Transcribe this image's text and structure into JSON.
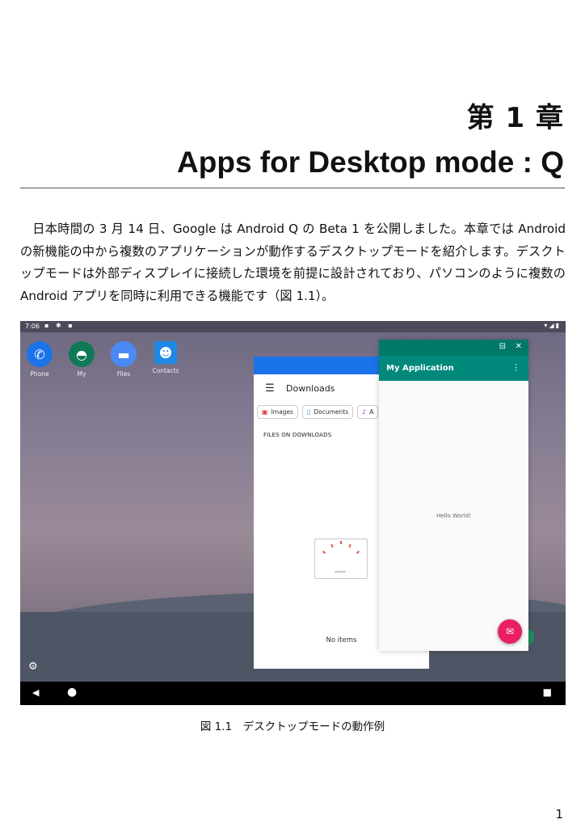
{
  "chapter": "第 1 章",
  "title": "Apps for Desktop mode : Q",
  "paragraph": "日本時間の 3 月 14 日、Google は Android Q の Beta 1 を公開しました。本章では Android の新機能の中から複数のアプリケーションが動作するデスクトップモードを紹介します。デスクトップモードは外部ディスプレイに接続した環境を前提に設計されており、パソコンのように複数の Android アプリを同時に利用できる機能です（図 1.1）。",
  "screenshot": {
    "status_time": "7:06",
    "dock": [
      {
        "label": "Phone",
        "icon": "phone-icon",
        "color": "#1a73e8"
      },
      {
        "label": "My",
        "icon": "android-icon",
        "color": "#0f7a57"
      },
      {
        "label": "Files",
        "icon": "folder-icon",
        "color": "#4a8af4"
      },
      {
        "label": "Contacts",
        "icon": "contacts-icon",
        "color": "#1e88e5"
      }
    ],
    "files_window": {
      "title": "Downloads",
      "chips": [
        {
          "label": "Images",
          "icon": "image-icon",
          "color": "#e53935"
        },
        {
          "label": "Documents",
          "icon": "document-icon",
          "color": "#039be5"
        },
        {
          "label": "A",
          "icon": "audio-icon",
          "color": "#8e24aa"
        }
      ],
      "section": "FILES ON DOWNLOADS",
      "empty": "No items"
    },
    "app_window": {
      "title": "My Application",
      "body": "Hello World!",
      "caption_buttons": [
        "maximize-icon",
        "close-icon"
      ]
    }
  },
  "figure_caption": "図 1.1　デスクトップモードの動作例",
  "page_number": "1"
}
